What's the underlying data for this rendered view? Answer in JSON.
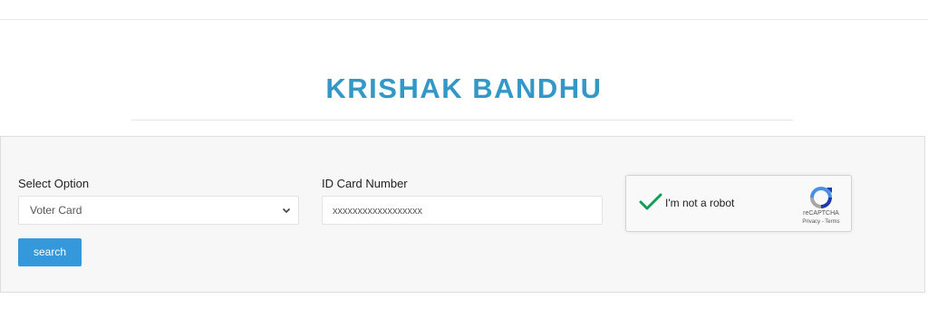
{
  "header": {
    "title": "KRISHAK BANDHU"
  },
  "form": {
    "select_label": "Select Option",
    "select_value": "Voter Card",
    "id_label": "ID Card Number",
    "id_value": "xxxxxxxxxxxxxxxxxx",
    "search_label": "search"
  },
  "captcha": {
    "label": "I'm not a robot",
    "brand": "reCAPTCHA",
    "privacy": "Privacy",
    "separator": " - ",
    "terms": "Terms",
    "checked": true,
    "check_color": "#0f9d58",
    "icon": "recaptcha-logo-icon"
  },
  "colors": {
    "accent": "#3498c7",
    "button": "#3498db",
    "panel_bg": "#f7f7f7"
  }
}
